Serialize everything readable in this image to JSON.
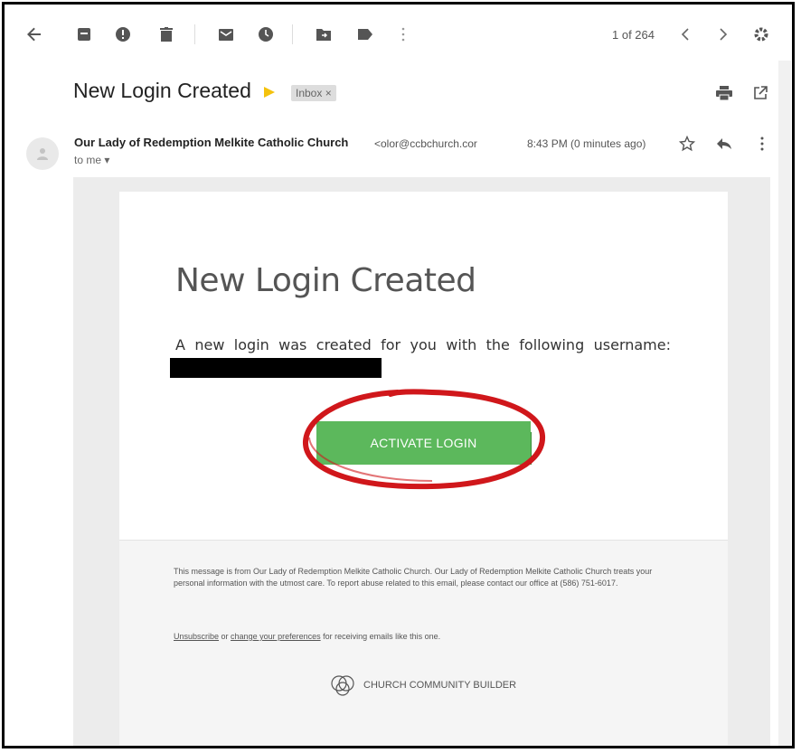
{
  "toolbar": {
    "icons": [
      "back-arrow-icon",
      "archive-icon",
      "report-spam-icon",
      "delete-icon",
      "mark-unread-icon",
      "snooze-icon",
      "move-to-icon",
      "label-icon",
      "more-icon"
    ],
    "pager_text": "1 of 264"
  },
  "email": {
    "subject": "New Login Created",
    "label": "Inbox ×",
    "sender_name": "Our Lady of Redemption Melkite Catholic Church",
    "sender_email": "<olor@ccbchurch.cor",
    "to_text": "to me ▾",
    "timestamp": "8:43 PM (0 minutes ago)"
  },
  "card": {
    "title": "New Login Created",
    "body": "A new login was created for you with the following username:",
    "button_label": "ACTIVATE LOGIN"
  },
  "footer": {
    "notice": "This message is from Our Lady of Redemption Melkite Catholic Church. Our Lady of Redemption Melkite Catholic Church treats your personal information with the utmost care. To report abuse related to this email, please contact our office at (586) 751-6017.",
    "unsubscribe": "Unsubscribe",
    "or_text": " or ",
    "change_prefs": "change your preferences",
    "prefs_suffix": " for receiving emails like this one.",
    "brand": "CHURCH COMMUNITY BUILDER"
  },
  "colors": {
    "button_green": "#5cb85c",
    "highlight_red": "#d0171b",
    "important_yellow": "#f4c20d"
  }
}
